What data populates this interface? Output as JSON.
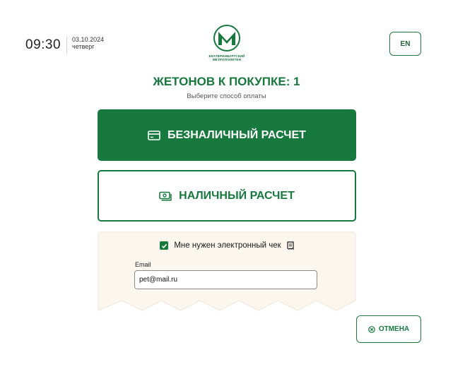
{
  "clock": {
    "time": "09:30",
    "date": "03.10.2024",
    "weekday": "четверг"
  },
  "logo": {
    "line1": "ЕКАТЕРИНБУРГСКИЙ",
    "line2": "МЕТРОПОЛИТЕН"
  },
  "language_button": "EN",
  "heading": "ЖЕТОНОВ К ПОКУПКЕ: 1",
  "subheading": "Выберите способ оплаты",
  "payment": {
    "cashless_label": "БЕЗНАЛИЧНЫЙ РАСЧЕТ",
    "cash_label": "НАЛИЧНЫЙ РАСЧЕТ"
  },
  "receipt": {
    "checkbox_label": "Мне нужен электронный чек",
    "checked": true,
    "email_label": "Email",
    "email_value": "pet@mail.ru"
  },
  "cancel_button": "ОТМЕНА",
  "colors": {
    "accent": "#17793d",
    "receipt_bg": "#fbf7ef"
  },
  "icons": [
    "card-icon",
    "cash-icon",
    "check-icon",
    "receipt-icon",
    "cancel-circle-icon"
  ]
}
